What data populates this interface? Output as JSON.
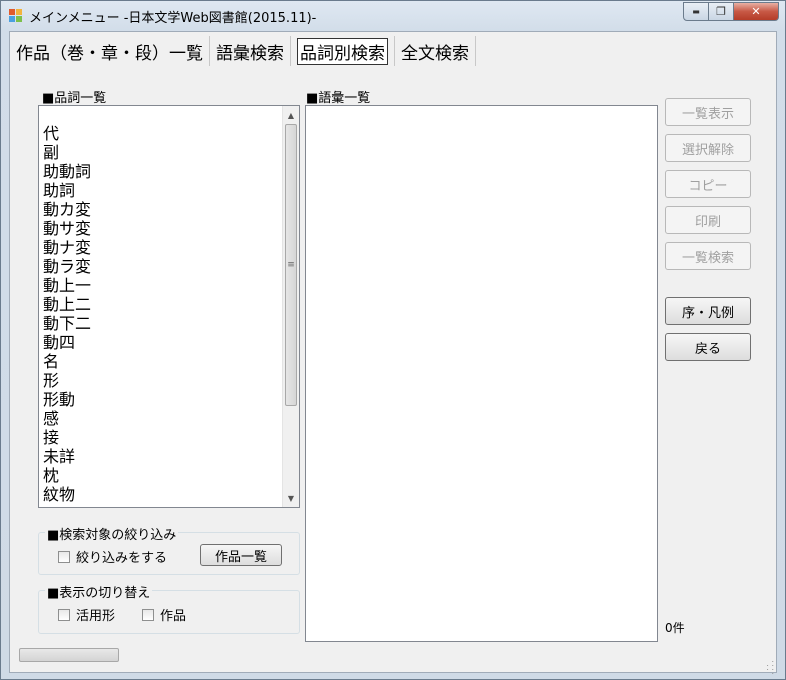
{
  "window": {
    "title": "メインメニュー -日本文学Web図書館(2015.11)-"
  },
  "caption": {
    "minimize": "▬",
    "maximize": "❐",
    "close": "✕"
  },
  "tabs": [
    {
      "label": "作品（巻・章・段）一覧"
    },
    {
      "label": "語彙検索"
    },
    {
      "label": "品詞別検索"
    },
    {
      "label": "全文検索"
    }
  ],
  "pos_section": {
    "label": "■品詞一覧",
    "items": [
      "代",
      "副",
      "助動詞",
      "助詞",
      "動カ変",
      "動サ変",
      "動ナ変",
      "動ラ変",
      "動上一",
      "動上二",
      "動下二",
      "動四",
      "名",
      "形",
      "形動",
      "感",
      "接",
      "未詳",
      "枕",
      "紋物"
    ]
  },
  "vocab_section": {
    "label": "■語彙一覧"
  },
  "buttons": {
    "list_display": "一覧表示",
    "clear_selection": "選択解除",
    "copy": "コピー",
    "print": "印刷",
    "list_search": "一覧検索",
    "preface": "序・凡例",
    "back": "戻る"
  },
  "filter_group": {
    "title": "■検索対象の絞り込み",
    "checkbox": "絞り込みをする",
    "works_button": "作品一覧"
  },
  "display_group": {
    "title": "■表示の切り替え",
    "conjugation": "活用形",
    "works": "作品"
  },
  "result_count": "0件",
  "scrollbar": {
    "up_arrow": "▲",
    "down_arrow": "▼",
    "thumb_grip": "≡"
  }
}
